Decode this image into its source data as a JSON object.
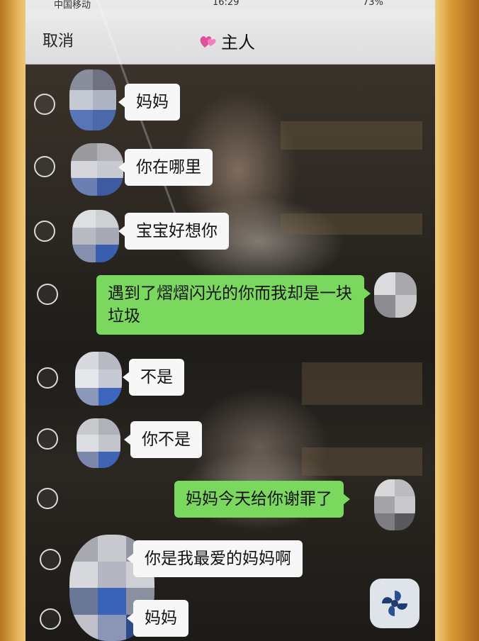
{
  "status_bar": {
    "carrier": "中国移动",
    "time": "16:29",
    "battery": "73%"
  },
  "nav": {
    "cancel_label": "取消",
    "title": "主人",
    "title_icon": "heart-icon"
  },
  "messages": [
    {
      "side": "in",
      "text": "妈妈"
    },
    {
      "side": "in",
      "text": "你在哪里"
    },
    {
      "side": "in",
      "text": "宝宝好想你"
    },
    {
      "side": "out",
      "text": "遇到了熠熠闪光的你而我却是一块垃圾"
    },
    {
      "side": "in",
      "text": "不是"
    },
    {
      "side": "in",
      "text": "你不是"
    },
    {
      "side": "out",
      "text": "妈妈今天给你谢罪了"
    },
    {
      "side": "in",
      "text": "你是我最爱的妈妈啊"
    },
    {
      "side": "in",
      "text": "妈妈"
    }
  ],
  "floating_button": {
    "icon": "pinwheel-icon"
  },
  "colors": {
    "bubble_out": "#7bd85f",
    "bubble_in": "#f7f7f7",
    "nav_bg": "#e6e6e8"
  }
}
